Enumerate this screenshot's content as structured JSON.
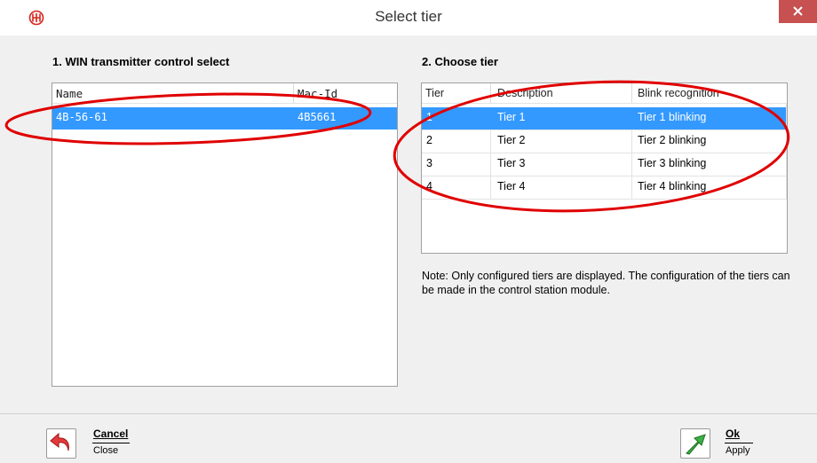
{
  "window": {
    "title": "Select tier",
    "logo_icon": "company-logo-icon",
    "close_icon": "close-icon"
  },
  "left_panel": {
    "heading": "1. WIN transmitter control select",
    "columns": [
      "Name",
      "Mac-Id"
    ],
    "rows": [
      {
        "name": "4B-56-61",
        "mac_id": "4B5661",
        "selected": true
      }
    ]
  },
  "right_panel": {
    "heading": "2. Choose tier",
    "columns": [
      "Tier",
      "Description",
      "Blink recognition"
    ],
    "rows": [
      {
        "tier": "1",
        "description": "Tier 1",
        "blink": "Tier 1 blinking",
        "selected": true
      },
      {
        "tier": "2",
        "description": "Tier 2",
        "blink": "Tier 2 blinking",
        "selected": false
      },
      {
        "tier": "3",
        "description": "Tier 3",
        "blink": "Tier 3 blinking",
        "selected": false
      },
      {
        "tier": "4",
        "description": "Tier 4",
        "blink": "Tier 4 blinking",
        "selected": false
      }
    ],
    "note": "Note: Only configured tiers are displayed. The configuration of the tiers can be made in the control station module."
  },
  "footer": {
    "cancel_label": "Cancel",
    "cancel_sub": "Close",
    "cancel_icon": "undo-arrow-icon",
    "ok_label": "Ok",
    "ok_sub": "Apply",
    "ok_icon": "green-arrow-icon"
  },
  "colors": {
    "selection": "#3399ff",
    "annotation": "#e00000",
    "close_button": "#c75050"
  }
}
